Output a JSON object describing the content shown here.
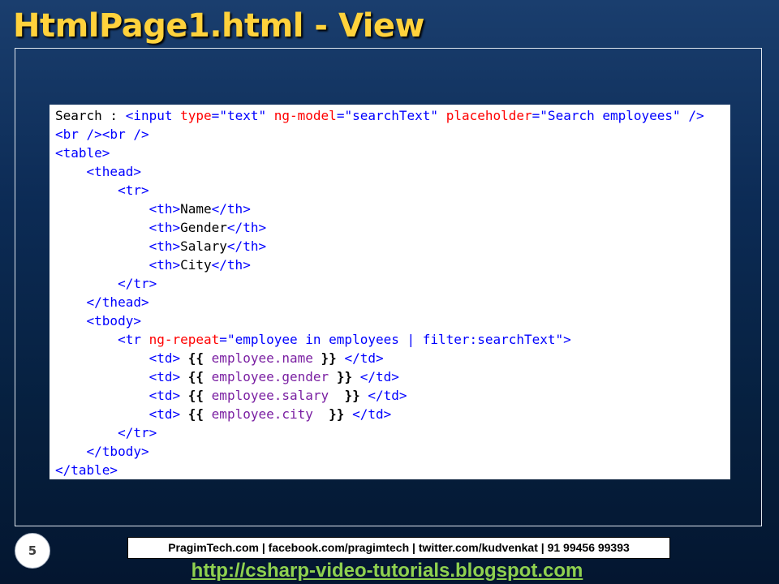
{
  "slide": {
    "title": "HtmlPage1.html - View",
    "number": "5",
    "colors": {
      "title": "#ffd23c",
      "tag": "#0000ff",
      "attribute": "#ff0000",
      "value": "#0000ff",
      "expression": "#7a1fa2",
      "link": "#8fd14f"
    }
  },
  "code": {
    "lines": [
      {
        "indent": 0,
        "tokens": [
          {
            "t": "text",
            "v": "Search : "
          },
          {
            "t": "tag",
            "v": "<input "
          },
          {
            "t": "attr",
            "v": "type"
          },
          {
            "t": "tag",
            "v": "="
          },
          {
            "t": "val",
            "v": "\"text\" "
          },
          {
            "t": "attr",
            "v": "ng-model"
          },
          {
            "t": "tag",
            "v": "="
          },
          {
            "t": "val",
            "v": "\"searchText\" "
          },
          {
            "t": "attr",
            "v": "placeholder"
          },
          {
            "t": "tag",
            "v": "="
          },
          {
            "t": "val",
            "v": "\"Search employees\" "
          },
          {
            "t": "tag",
            "v": "/>"
          }
        ]
      },
      {
        "indent": 0,
        "tokens": [
          {
            "t": "tag",
            "v": "<br /><br />"
          }
        ]
      },
      {
        "indent": 0,
        "tokens": [
          {
            "t": "tag",
            "v": "<table>"
          }
        ]
      },
      {
        "indent": 1,
        "tokens": [
          {
            "t": "tag",
            "v": "<thead>"
          }
        ]
      },
      {
        "indent": 2,
        "tokens": [
          {
            "t": "tag",
            "v": "<tr>"
          }
        ]
      },
      {
        "indent": 3,
        "tokens": [
          {
            "t": "tag",
            "v": "<th>"
          },
          {
            "t": "text",
            "v": "Name"
          },
          {
            "t": "tag",
            "v": "</th>"
          }
        ]
      },
      {
        "indent": 3,
        "tokens": [
          {
            "t": "tag",
            "v": "<th>"
          },
          {
            "t": "text",
            "v": "Gender"
          },
          {
            "t": "tag",
            "v": "</th>"
          }
        ]
      },
      {
        "indent": 3,
        "tokens": [
          {
            "t": "tag",
            "v": "<th>"
          },
          {
            "t": "text",
            "v": "Salary"
          },
          {
            "t": "tag",
            "v": "</th>"
          }
        ]
      },
      {
        "indent": 3,
        "tokens": [
          {
            "t": "tag",
            "v": "<th>"
          },
          {
            "t": "text",
            "v": "City"
          },
          {
            "t": "tag",
            "v": "</th>"
          }
        ]
      },
      {
        "indent": 2,
        "tokens": [
          {
            "t": "tag",
            "v": "</tr>"
          }
        ]
      },
      {
        "indent": 1,
        "tokens": [
          {
            "t": "tag",
            "v": "</thead>"
          }
        ]
      },
      {
        "indent": 1,
        "tokens": [
          {
            "t": "tag",
            "v": "<tbody>"
          }
        ]
      },
      {
        "indent": 2,
        "tokens": [
          {
            "t": "tag",
            "v": "<tr "
          },
          {
            "t": "attr",
            "v": "ng-repeat"
          },
          {
            "t": "tag",
            "v": "="
          },
          {
            "t": "val",
            "v": "\"employee in employees | filter:searchText\""
          },
          {
            "t": "tag",
            "v": ">"
          }
        ]
      },
      {
        "indent": 3,
        "tokens": [
          {
            "t": "tag",
            "v": "<td>"
          },
          {
            "t": "text",
            "v": " "
          },
          {
            "t": "brace",
            "v": "{{"
          },
          {
            "t": "text",
            "v": " "
          },
          {
            "t": "expr",
            "v": "employee.name"
          },
          {
            "t": "text",
            "v": " "
          },
          {
            "t": "brace",
            "v": "}}"
          },
          {
            "t": "text",
            "v": " "
          },
          {
            "t": "tag",
            "v": "</td>"
          }
        ]
      },
      {
        "indent": 3,
        "tokens": [
          {
            "t": "tag",
            "v": "<td>"
          },
          {
            "t": "text",
            "v": " "
          },
          {
            "t": "brace",
            "v": "{{"
          },
          {
            "t": "text",
            "v": " "
          },
          {
            "t": "expr",
            "v": "employee.gender"
          },
          {
            "t": "text",
            "v": " "
          },
          {
            "t": "brace",
            "v": "}}"
          },
          {
            "t": "text",
            "v": " "
          },
          {
            "t": "tag",
            "v": "</td>"
          }
        ]
      },
      {
        "indent": 3,
        "tokens": [
          {
            "t": "tag",
            "v": "<td>"
          },
          {
            "t": "text",
            "v": " "
          },
          {
            "t": "brace",
            "v": "{{"
          },
          {
            "t": "text",
            "v": " "
          },
          {
            "t": "expr",
            "v": "employee.salary"
          },
          {
            "t": "text",
            "v": "  "
          },
          {
            "t": "brace",
            "v": "}}"
          },
          {
            "t": "text",
            "v": " "
          },
          {
            "t": "tag",
            "v": "</td>"
          }
        ]
      },
      {
        "indent": 3,
        "tokens": [
          {
            "t": "tag",
            "v": "<td>"
          },
          {
            "t": "text",
            "v": " "
          },
          {
            "t": "brace",
            "v": "{{"
          },
          {
            "t": "text",
            "v": " "
          },
          {
            "t": "expr",
            "v": "employee.city"
          },
          {
            "t": "text",
            "v": "  "
          },
          {
            "t": "brace",
            "v": "}}"
          },
          {
            "t": "text",
            "v": " "
          },
          {
            "t": "tag",
            "v": "</td>"
          }
        ]
      },
      {
        "indent": 2,
        "tokens": [
          {
            "t": "tag",
            "v": "</tr>"
          }
        ]
      },
      {
        "indent": 1,
        "tokens": [
          {
            "t": "tag",
            "v": "</tbody>"
          }
        ]
      },
      {
        "indent": 0,
        "tokens": [
          {
            "t": "tag",
            "v": "</table>"
          }
        ]
      }
    ]
  },
  "footer": {
    "contact": "PragimTech.com | facebook.com/pragimtech  | twitter.com/kudvenkat  | 91 99456 99393",
    "link": "http://csharp-video-tutorials.blogspot.com"
  }
}
